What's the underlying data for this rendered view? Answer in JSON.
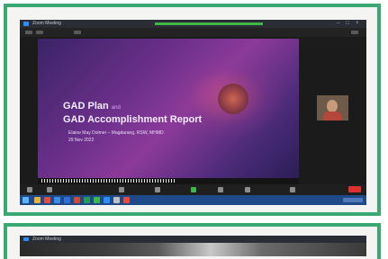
{
  "window": {
    "title": "Zoom Meeting"
  },
  "slide": {
    "small_header": "",
    "title_line1": "GAD Plan",
    "title_and": "and",
    "title_line2": "GAD Accomplishment Report",
    "presenter": "Elaine May Dolmer – Magdarang, RSW, MHMD",
    "date": "29 Nov 2022",
    "footer_line1": "",
    "footer_line2": ""
  },
  "second_window": {
    "title": "Zoom Meeting"
  },
  "colors": {
    "frame": "#3aa872",
    "zoom_green": "#3fb84a",
    "end_red": "#e0302e",
    "taskbar": "#1e4a8a"
  }
}
